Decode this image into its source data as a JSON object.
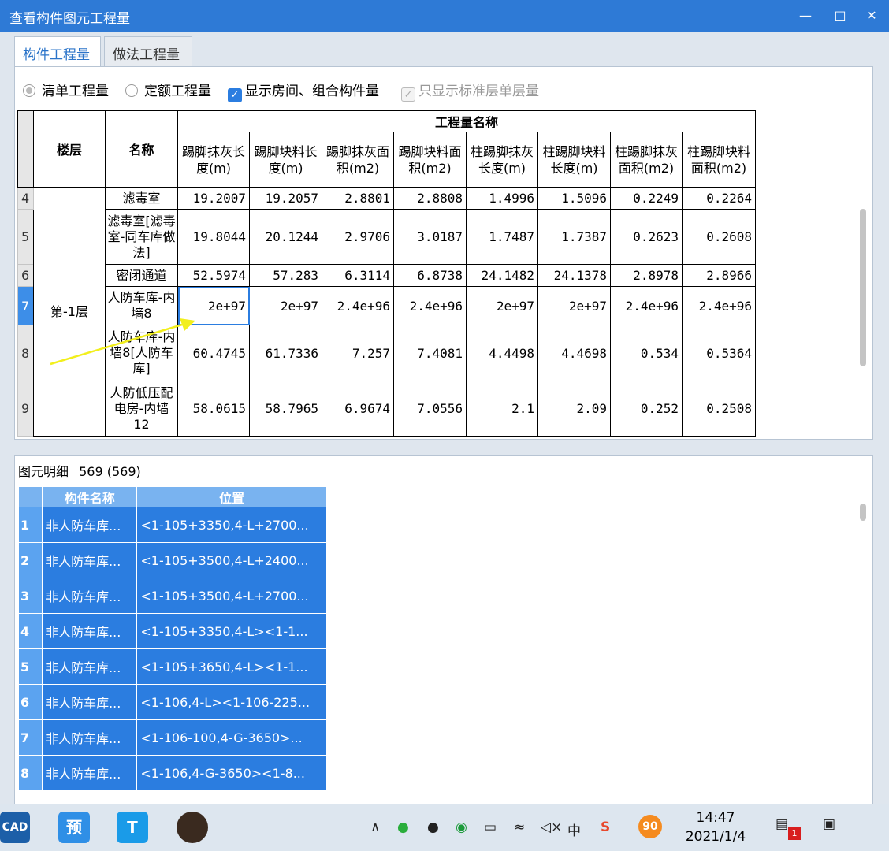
{
  "window": {
    "title": "查看构件图元工程量",
    "minimize": "—",
    "maximize": "□",
    "close": "✕"
  },
  "tabs": [
    {
      "label": "构件工程量"
    },
    {
      "label": "做法工程量"
    }
  ],
  "options": {
    "radio_list": "清单工程量",
    "radio_quota": "定额工程量",
    "check_rooms": "显示房间、组合构件量",
    "check_std": "只显示标准层单层量"
  },
  "table": {
    "header_floor": "楼层",
    "header_name": "名称",
    "header_group": "工程量名称",
    "columns": [
      "踢脚抹灰长度(m)",
      "踢脚块料长度(m)",
      "踢脚抹灰面积(m2)",
      "踢脚块料面积(m2)",
      "柱踢脚抹灰长度(m)",
      "柱踢脚块料长度(m)",
      "柱踢脚抹灰面积(m2)",
      "柱踢脚块料面积(m2)"
    ],
    "floor": "第-1层",
    "rows": [
      {
        "num": "4",
        "name": "滤毒室",
        "values": [
          "19.2007",
          "19.2057",
          "2.8801",
          "2.8808",
          "1.4996",
          "1.5096",
          "0.2249",
          "0.2264"
        ]
      },
      {
        "num": "5",
        "name": "滤毒室[滤毒室-同车库做法]",
        "values": [
          "19.8044",
          "20.1244",
          "2.9706",
          "3.0187",
          "1.7487",
          "1.7387",
          "0.2623",
          "0.2608"
        ]
      },
      {
        "num": "6",
        "name": "密闭通道",
        "values": [
          "52.5974",
          "57.283",
          "6.3114",
          "6.8738",
          "24.1482",
          "24.1378",
          "2.8978",
          "2.8966"
        ]
      },
      {
        "num": "7",
        "name": "人防车库-内墙8",
        "values": [
          "2e+97",
          "2e+97",
          "2.4e+96",
          "2.4e+96",
          "2e+97",
          "2e+97",
          "2.4e+96",
          "2.4e+96"
        ]
      },
      {
        "num": "8",
        "name": "人防车库-内墙8[人防车库]",
        "values": [
          "60.4745",
          "61.7336",
          "7.257",
          "7.4081",
          "4.4498",
          "4.4698",
          "0.534",
          "0.5364"
        ]
      },
      {
        "num": "9",
        "name": "人防低压配电房-内墙12",
        "values": [
          "58.0615",
          "58.7965",
          "6.9674",
          "7.0556",
          "2.1",
          "2.09",
          "0.252",
          "0.2508"
        ]
      }
    ]
  },
  "detail": {
    "label": "图元明细",
    "count": "569 (569)",
    "col_name": "构件名称",
    "col_pos": "位置",
    "rows": [
      {
        "num": "1",
        "name": "非人防车库...",
        "pos": "<1-105+3350,4-L+2700..."
      },
      {
        "num": "2",
        "name": "非人防车库...",
        "pos": "<1-105+3500,4-L+2400..."
      },
      {
        "num": "3",
        "name": "非人防车库...",
        "pos": "<1-105+3500,4-L+2700..."
      },
      {
        "num": "4",
        "name": "非人防车库...",
        "pos": "<1-105+3350,4-L><1-1..."
      },
      {
        "num": "5",
        "name": "非人防车库...",
        "pos": "<1-105+3650,4-L><1-1..."
      },
      {
        "num": "6",
        "name": "非人防车库...",
        "pos": "<1-106,4-L><1-106-225..."
      },
      {
        "num": "7",
        "name": "非人防车库...",
        "pos": "<1-106-100,4-G-3650>..."
      },
      {
        "num": "8",
        "name": "非人防车库...",
        "pos": "<1-106,4-G-3650><1-8..."
      }
    ]
  },
  "taskbar": {
    "apps": [
      {
        "label": "CAD",
        "color": "#1c5fa8"
      },
      {
        "label": "预",
        "color": "#2f8fe6"
      },
      {
        "label": "T",
        "color": "#1a9be8"
      }
    ],
    "tray": {
      "ime": "中",
      "badge": "90",
      "notif": "1"
    },
    "time": "14:47",
    "date": "2021/1/4"
  }
}
